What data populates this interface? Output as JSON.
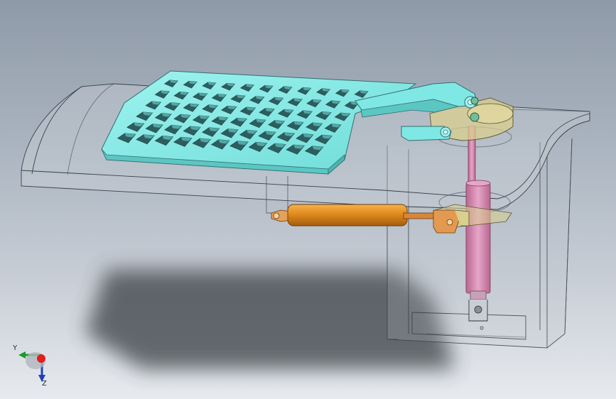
{
  "viewport": {
    "background_top": "#8f9aa8",
    "background_bottom": "#e7eaee"
  },
  "colors": {
    "plate": "#7fe8e4",
    "plate_edge": "#2f6f70",
    "cylinder": "#e08a1e",
    "rod": "#d788b4",
    "housing_edge": "#3a3f46",
    "axis_x": "#e0201b",
    "axis_y": "#1a9a2a",
    "axis_z": "#1f3fbf"
  },
  "model": {
    "parts": [
      "perforated-plate",
      "curved-housing",
      "hinge-bracket",
      "hydraulic-cylinder-horizontal",
      "hydraulic-cylinder-vertical",
      "pivot-base"
    ]
  },
  "triad": {
    "y_label": "Y",
    "z_label": "Z"
  }
}
